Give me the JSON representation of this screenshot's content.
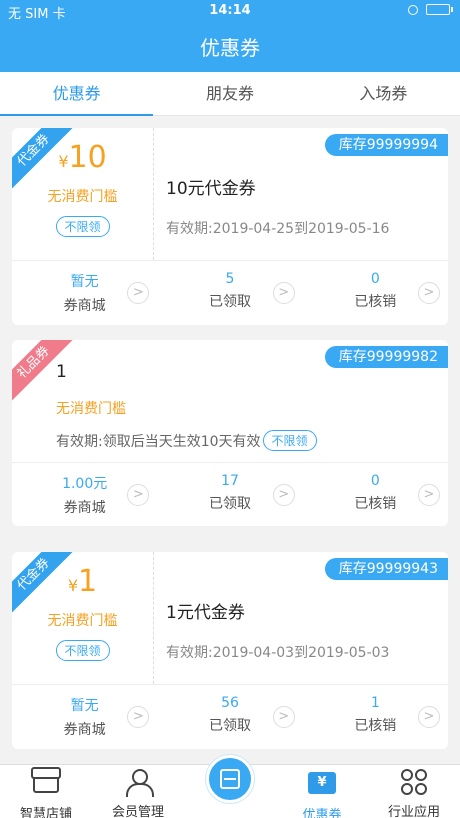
{
  "status_bar": {
    "carrier": "无 SIM 卡",
    "time": "14:14"
  },
  "header": {
    "title": "优惠券"
  },
  "tabs": [
    {
      "label": "优惠券",
      "active": true
    },
    {
      "label": "朋友券",
      "active": false
    },
    {
      "label": "入场券",
      "active": false
    }
  ],
  "coupons": [
    {
      "tag": "代金券",
      "stock": "库存99999994",
      "currency": "¥",
      "amount": "10",
      "threshold": "无消费门槛",
      "limit_badge": "不限领",
      "name": "10元代金券",
      "validity": "有效期:2019-04-25到2019-05-16",
      "stats": [
        {
          "value": "暂无",
          "label": "券商城"
        },
        {
          "value": "5",
          "label": "已领取"
        },
        {
          "value": "0",
          "label": "已核销"
        }
      ]
    },
    {
      "tag": "礼品券",
      "stock": "库存99999982",
      "name": "1",
      "threshold": "无消费门槛",
      "validity": "有效期:领取后当天生效10天有效",
      "limit_badge": "不限领",
      "stats": [
        {
          "value": "1.00元",
          "label": "券商城"
        },
        {
          "value": "17",
          "label": "已领取"
        },
        {
          "value": "0",
          "label": "已核销"
        }
      ]
    },
    {
      "tag": "代金券",
      "stock": "库存99999943",
      "currency": "¥",
      "amount": "1",
      "threshold": "无消费门槛",
      "limit_badge": "不限领",
      "name": "1元代金券",
      "validity": "有效期:2019-04-03到2019-05-03",
      "stats": [
        {
          "value": "暂无",
          "label": "券商城"
        },
        {
          "value": "56",
          "label": "已领取"
        },
        {
          "value": "1",
          "label": "已核销"
        }
      ]
    }
  ],
  "bottom_nav": [
    {
      "label": "智慧店铺",
      "icon": "store-icon"
    },
    {
      "label": "会员管理",
      "icon": "member-icon"
    },
    {
      "label": "",
      "icon": "scan-icon"
    },
    {
      "label": "优惠券",
      "icon": "coupon-icon",
      "active": true
    },
    {
      "label": "行业应用",
      "icon": "apps-icon"
    }
  ],
  "colors": {
    "primary": "#39a9f3",
    "price": "#f6a120",
    "gift_tag": "#f07b8a"
  }
}
